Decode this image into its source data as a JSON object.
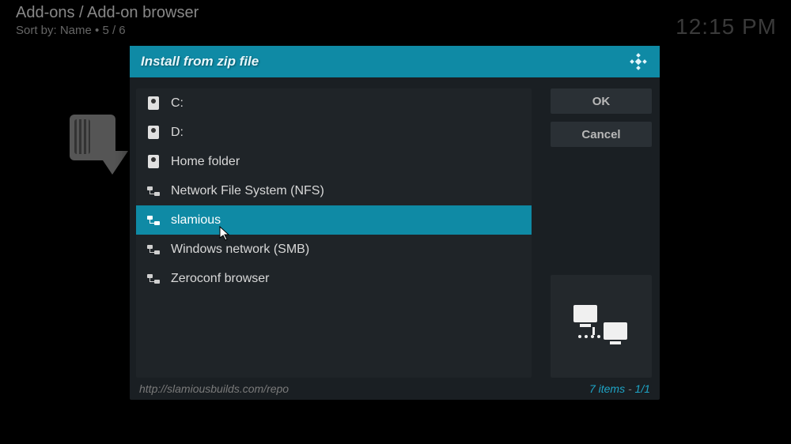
{
  "background": {
    "breadcrumb": "Add-ons / Add-on browser",
    "sortby": "Sort by: Name  •  5 / 6",
    "clock": "12:15 PM"
  },
  "dialog": {
    "title": "Install from zip file",
    "buttons": {
      "ok": "OK",
      "cancel": "Cancel"
    },
    "items": [
      {
        "label": "C:",
        "icon": "drive"
      },
      {
        "label": "D:",
        "icon": "drive"
      },
      {
        "label": "Home folder",
        "icon": "drive"
      },
      {
        "label": "Network File System (NFS)",
        "icon": "network"
      },
      {
        "label": "slamious",
        "icon": "network",
        "selected": true
      },
      {
        "label": "Windows network (SMB)",
        "icon": "network"
      },
      {
        "label": "Zeroconf browser",
        "icon": "network"
      }
    ],
    "footer": {
      "url": "http://slamiousbuilds.com/repo",
      "count_num": "7 items",
      "count_page": "1/1"
    }
  }
}
